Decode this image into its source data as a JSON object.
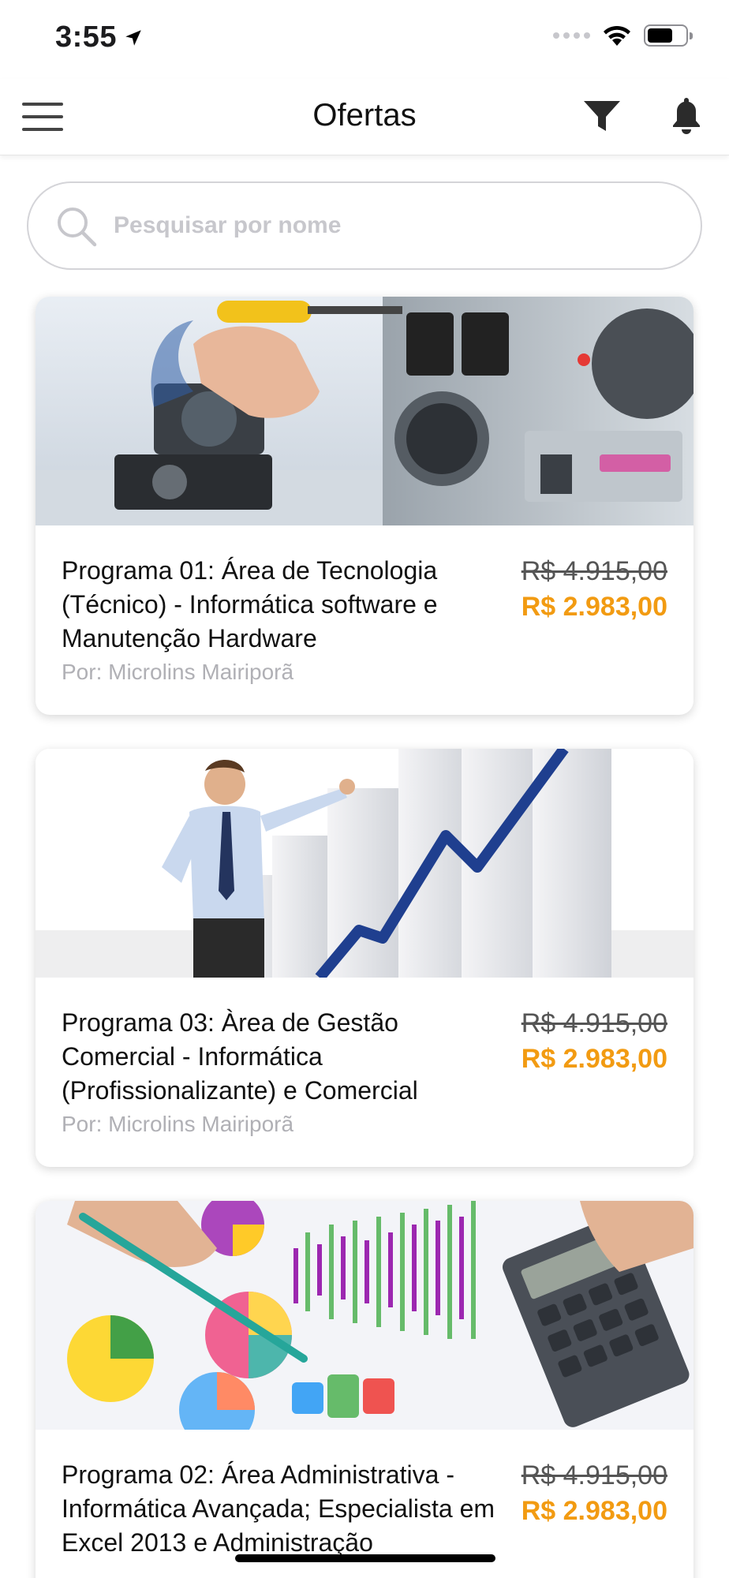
{
  "status_bar": {
    "time": "3:55",
    "icons": [
      "location-arrow-icon",
      "signal-dots-icon",
      "wifi-icon",
      "battery-icon"
    ],
    "battery_level": 0.68
  },
  "nav": {
    "title": "Ofertas",
    "icons": [
      "hamburger-menu-icon",
      "filter-icon",
      "bell-icon"
    ]
  },
  "search": {
    "placeholder": "Pesquisar por nome",
    "value": ""
  },
  "offers": [
    {
      "title": "Programa 01: Área de Tecnologia (Técnico) - Informática software e Manutenção Hardware",
      "author": "Por: Microlins Mairiporã",
      "old_price": "R$ 4.915,00",
      "price": "R$ 2.983,00",
      "image": "computer-repair-photo"
    },
    {
      "title": "Programa 03: Àrea de Gestão Comercial - Informática (Profissionalizante) e Comercial",
      "author": "Por: Microlins Mairiporã",
      "old_price": "R$ 4.915,00",
      "price": "R$ 2.983,00",
      "image": "business-growth-chart-photo"
    },
    {
      "title": "Programa 02: Área Administrativa - Informática Avançada; Especialista em Excel 2013 e Administração",
      "author": "",
      "old_price": "R$ 4.915,00",
      "price": "R$ 2.983,00",
      "image": "financial-charts-calculator-photo"
    }
  ],
  "colors": {
    "accent_price": "#f29b12",
    "old_price": "#555555",
    "author_text": "#b0b0b5",
    "placeholder": "#c7c7cc"
  }
}
